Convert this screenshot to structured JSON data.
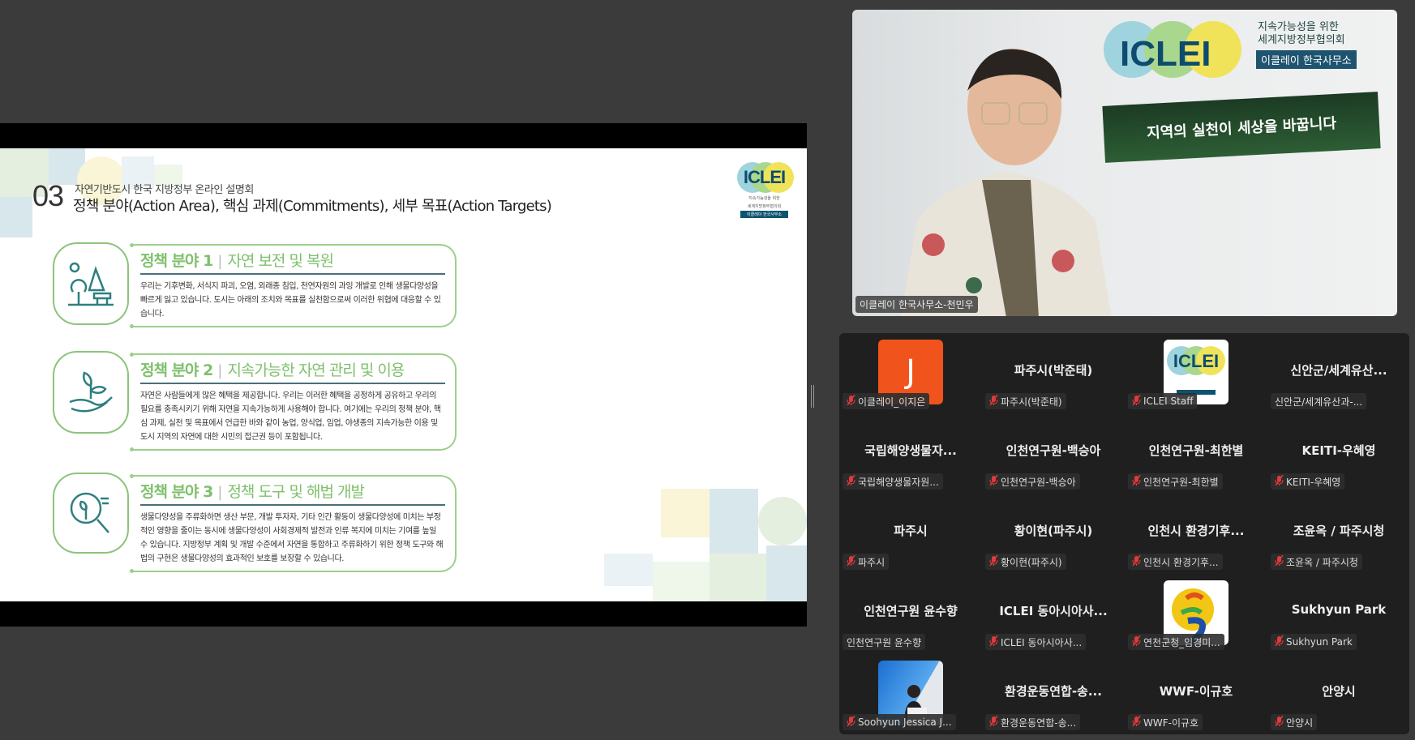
{
  "slide": {
    "number": "03",
    "subtitle": "자연기반도시 한국 지방정부 온라인 설명회",
    "title": "정책 분야(Action Area), 핵심 과제(Commitments), 세부 목표(Action Targets)",
    "logo": {
      "word": "ICLEI",
      "line1": "지속가능성을 위한",
      "line2": "세계지방정부협의회",
      "badge": "이클레이 한국사무소"
    },
    "cards": [
      {
        "num": "정책 분야 1",
        "title": "자연 보전 및 복원",
        "body": "우리는 기후변화, 서식지 파괴, 오염, 외래종 침입, 천연자원의 과잉 개발로 인해 생물다양성을 빠르게 잃고 있습니다. 도시는 아래의 조치와 목표를 실천함으로써 이러한 위협에 대응할 수 있습니다."
      },
      {
        "num": "정책 분야 2",
        "title": "지속가능한 자연 관리 및 이용",
        "body": "자연은 사람들에게 많은 혜택을 제공합니다. 우리는 이러한 혜택을 공정하게 공유하고 우리의 필요를 충족시키기 위해 자연을 지속가능하게 사용해야 합니다. 여기에는 우리의 정책 분야, 핵심 과제, 실천 및 목표에서 언급한 바와 같이 농업, 양식업, 임업, 야생종의 지속가능한 이용 및 도시 지역의 자연에 대한 시민의 접근권 등이 포함됩니다."
      },
      {
        "num": "정책 분야 3",
        "title": "정책 도구 및 해법 개발",
        "body": "생물다양성을 주류화하면 생산 부문, 개발 투자자, 기타 인간 활동이 생물다양성에 미치는 부정적인 영향을 줄이는 동시에 생물다양성이 사회경제적 발전과 인류 복지에 미치는 기여를 높일 수 있습니다. 지방정부 계획 및 개발 수준에서 자연을 통합하고 주류화하기 위한 정책 도구와 해법의 구현은 생물다양성의 효과적인 보호를 보장할 수 있습니다."
      }
    ]
  },
  "speaker": {
    "name": "이클레이 한국사무소-천민우",
    "sign_slogan": "지역의 실천이 세상을 바꿉니다",
    "sign_logo": "ICLEI",
    "sign_line1": "지속가능성을 위한",
    "sign_line2": "세계지방정부협의회",
    "sign_badge": "이클레이 한국사무소"
  },
  "colors": {
    "accent_green": "#7fc06c",
    "mute_red": "#e03a3a",
    "avatar_orange": "#f0531c"
  },
  "participants": [
    {
      "display": "",
      "avatar": "letter",
      "letter": "J",
      "label": "이클레이_이지은",
      "muted": true
    },
    {
      "display": "파주시(박준태)",
      "label": "파주시(박준태)",
      "muted": true
    },
    {
      "display": "",
      "avatar": "iclei",
      "label": "ICLEI Staff",
      "muted": true
    },
    {
      "display": "신안군/세계유산...",
      "label": "신안군/세계유산과-...",
      "muted": false
    },
    {
      "display": "국립해양생물자...",
      "label": "국립해양생물자원...",
      "muted": true
    },
    {
      "display": "인천연구원-백승아",
      "label": "인천연구원-백승아",
      "muted": true
    },
    {
      "display": "인천연구원-최한별",
      "label": "인천연구원-최한별",
      "muted": true
    },
    {
      "display": "KEITI-우혜영",
      "label": "KEITI-우혜영",
      "muted": true
    },
    {
      "display": "파주시",
      "label": "파주시",
      "muted": true
    },
    {
      "display": "황이현(파주시)",
      "label": "황이현(파주시)",
      "muted": true
    },
    {
      "display": "인천시 환경기후...",
      "label": "인천시 환경기후...",
      "muted": true
    },
    {
      "display": "조윤옥 / 파주시청",
      "label": "조윤옥 / 파주시청",
      "muted": true
    },
    {
      "display": "인천연구원 윤수향",
      "label": "인천연구원 윤수향",
      "muted": false
    },
    {
      "display": "ICLEI 동아시아사...",
      "label": "ICLEI 동아시아사...",
      "muted": true
    },
    {
      "display": "",
      "avatar": "yeoncheon",
      "label": "연천군청_임경미...",
      "muted": true
    },
    {
      "display": "Sukhyun Park",
      "label": "Sukhyun Park",
      "muted": true
    },
    {
      "display": "",
      "avatar": "photo",
      "label": "Soohyun Jessica J...",
      "muted": true
    },
    {
      "display": "환경운동연합-송...",
      "label": "환경운동연합-송...",
      "muted": true
    },
    {
      "display": "WWF-이규호",
      "label": "WWF-이규호",
      "muted": true
    },
    {
      "display": "안양시",
      "label": "안양시",
      "muted": true
    }
  ]
}
